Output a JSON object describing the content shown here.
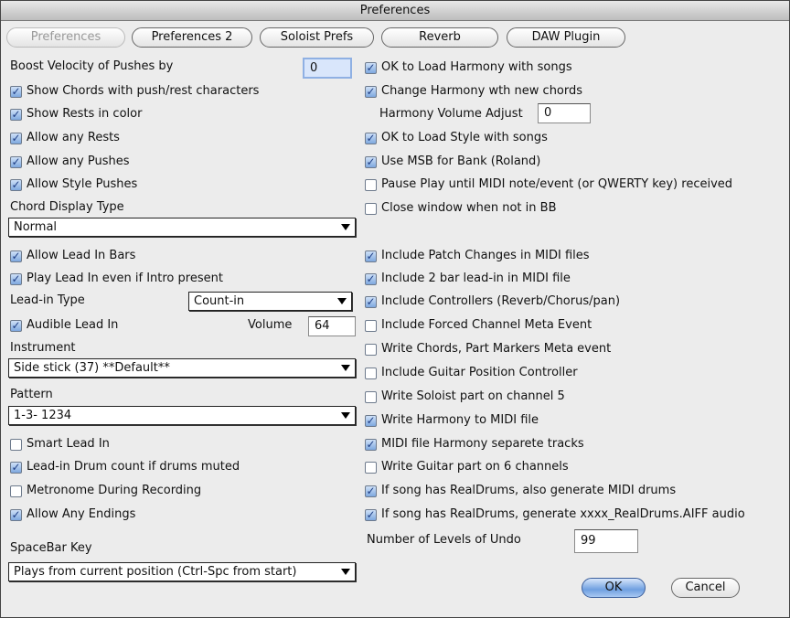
{
  "window": {
    "title": "Preferences"
  },
  "tabs": [
    {
      "label": "Preferences",
      "disabled": true
    },
    {
      "label": "Preferences 2"
    },
    {
      "label": "Soloist Prefs"
    },
    {
      "label": "Reverb"
    },
    {
      "label": "DAW Plugin"
    }
  ],
  "left": {
    "boost_label": "Boost Velocity of Pushes by",
    "boost_value": "0",
    "checks1": [
      {
        "label": "Show Chords with push/rest characters",
        "checked": true
      },
      {
        "label": "Show Rests in color",
        "checked": true
      },
      {
        "label": "Allow any Rests",
        "checked": true
      },
      {
        "label": "Allow any Pushes",
        "checked": true
      },
      {
        "label": "Allow Style Pushes",
        "checked": true
      }
    ],
    "chord_display_label": "Chord Display Type",
    "chord_display_value": "Normal",
    "checks2": [
      {
        "label": "Allow Lead In Bars",
        "checked": true
      },
      {
        "label": "Play Lead In even if Intro present",
        "checked": true
      }
    ],
    "leadin_type_label": "Lead-in Type",
    "leadin_type_value": "Count-in",
    "audible": {
      "label": "Audible Lead In",
      "checked": true
    },
    "volume_label": "Volume",
    "volume_value": "64",
    "instrument_label": "Instrument",
    "instrument_value": "Side stick (37) **Default**",
    "pattern_label": "Pattern",
    "pattern_value": "1-3- 1234",
    "checks3": [
      {
        "label": "Smart Lead In",
        "checked": false
      },
      {
        "label": "Lead-in Drum count if drums muted",
        "checked": true
      },
      {
        "label": "Metronome During Recording",
        "checked": false
      },
      {
        "label": "Allow Any Endings",
        "checked": true
      }
    ],
    "spacebar_label": "SpaceBar Key",
    "spacebar_value": "Plays from current position (Ctrl-Spc from start)"
  },
  "right": {
    "checks1": [
      {
        "label": "OK to Load Harmony with songs",
        "checked": true
      },
      {
        "label": "Change Harmony wth new chords",
        "checked": true
      }
    ],
    "harmony_volume_label": "Harmony Volume Adjust",
    "harmony_volume_value": "0",
    "checks2": [
      {
        "label": "OK to Load Style with songs",
        "checked": true
      },
      {
        "label": "Use MSB for Bank (Roland)",
        "checked": true
      },
      {
        "label": "Pause Play until MIDI note/event (or QWERTY key) received",
        "checked": false
      },
      {
        "label": "Close window when not in BB",
        "checked": false
      }
    ],
    "checks3": [
      {
        "label": "Include Patch Changes in MIDI files",
        "checked": true
      },
      {
        "label": "Include 2 bar lead-in in MIDI file",
        "checked": true
      },
      {
        "label": "Include Controllers (Reverb/Chorus/pan)",
        "checked": true
      },
      {
        "label": "Include Forced Channel Meta Event",
        "checked": false
      },
      {
        "label": "Write Chords, Part Markers Meta event",
        "checked": false
      },
      {
        "label": "Include Guitar Position Controller",
        "checked": false
      },
      {
        "label": "Write Soloist part on channel 5",
        "checked": false
      },
      {
        "label": "Write Harmony to MIDI file",
        "checked": true
      },
      {
        "label": "MIDI file Harmony separete tracks",
        "checked": true
      },
      {
        "label": "Write Guitar part on 6 channels",
        "checked": false
      },
      {
        "label": "If song has RealDrums, also generate MIDI drums",
        "checked": true
      },
      {
        "label": "If song has RealDrums, generate xxxx_RealDrums.AIFF audio",
        "checked": true
      }
    ],
    "undo_label": "Number of Levels of Undo",
    "undo_value": "99"
  },
  "buttons": {
    "ok": "OK",
    "cancel": "Cancel"
  }
}
